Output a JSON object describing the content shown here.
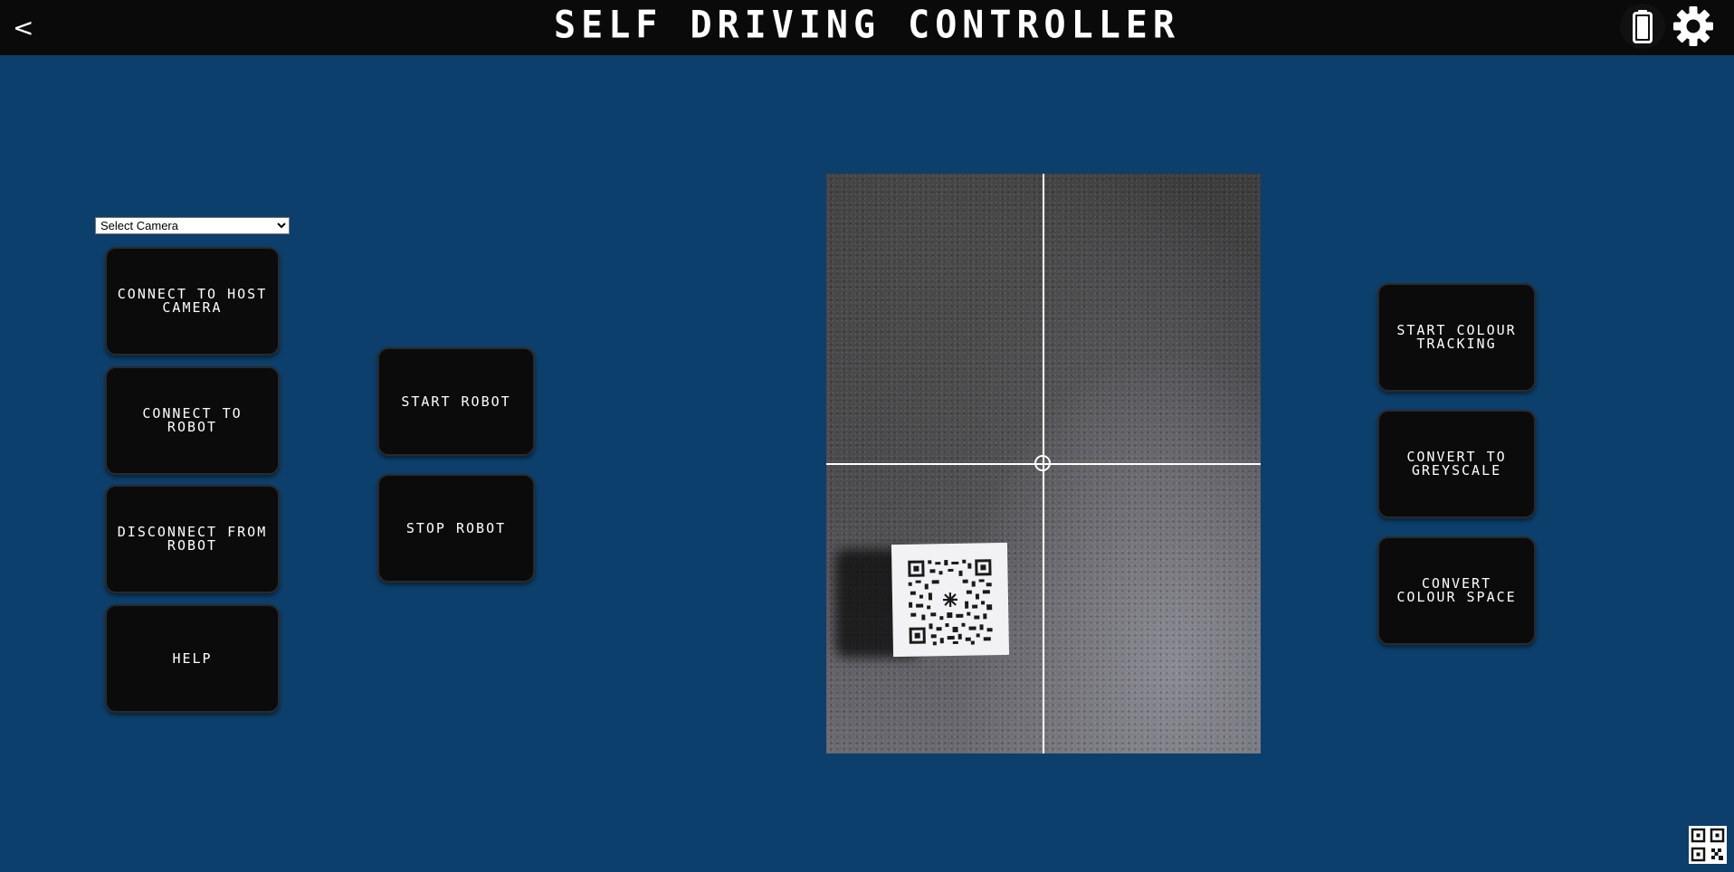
{
  "header": {
    "back_label": "<",
    "title": "SELF DRIVING CONTROLLER",
    "battery_icon": "battery-icon",
    "settings_icon": "gear-icon"
  },
  "camera_select": {
    "selected": "Select Camera"
  },
  "left_buttons": [
    {
      "label": "CONNECT TO HOST CAMERA"
    },
    {
      "label": "CONNECT TO ROBOT"
    },
    {
      "label": "DISCONNECT FROM ROBOT"
    },
    {
      "label": "HELP"
    }
  ],
  "middle_buttons": [
    {
      "label": "START ROBOT"
    },
    {
      "label": "STOP ROBOT"
    }
  ],
  "right_buttons": [
    {
      "label": "START COLOUR TRACKING"
    },
    {
      "label": "CONVERT TO GREYSCALE"
    },
    {
      "label": "CONVERT COLOUR SPACE"
    }
  ],
  "corner_icon": "qr-code-icon",
  "colors": {
    "background": "#0c3f6b",
    "topbar": "#0a0a0a",
    "button": "#0b0b0b",
    "text": "#ffffff"
  }
}
